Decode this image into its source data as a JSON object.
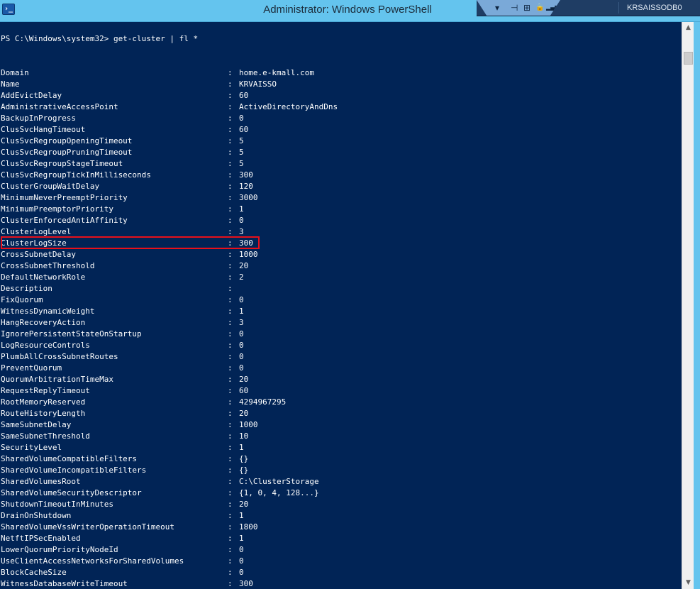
{
  "window": {
    "title": "Administrator: Windows PowerShell",
    "app_icon": "powershell-icon",
    "app_icon_glyph": "›_"
  },
  "remote_bar": {
    "icons": [
      "chevron-down-icon",
      "pin-icon",
      "network-icon",
      "lock-icon",
      "signal-icon"
    ],
    "glyphs": [
      "▾",
      "⊣",
      "⊞",
      "🔒",
      "▂▄▆"
    ],
    "host": "KRSAISSODB0"
  },
  "console": {
    "prompt": "PS C:\\Windows\\system32> get-cluster | fl *",
    "rows": [
      {
        "name": "Domain",
        "value": "home.e-kmall.com"
      },
      {
        "name": "Name",
        "value": "KRVAISSO"
      },
      {
        "name": "AddEvictDelay",
        "value": "60"
      },
      {
        "name": "AdministrativeAccessPoint",
        "value": "ActiveDirectoryAndDns"
      },
      {
        "name": "BackupInProgress",
        "value": "0"
      },
      {
        "name": "ClusSvcHangTimeout",
        "value": "60"
      },
      {
        "name": "ClusSvcRegroupOpeningTimeout",
        "value": "5"
      },
      {
        "name": "ClusSvcRegroupPruningTimeout",
        "value": "5"
      },
      {
        "name": "ClusSvcRegroupStageTimeout",
        "value": "5"
      },
      {
        "name": "ClusSvcRegroupTickInMilliseconds",
        "value": "300"
      },
      {
        "name": "ClusterGroupWaitDelay",
        "value": "120"
      },
      {
        "name": "MinimumNeverPreemptPriority",
        "value": "3000"
      },
      {
        "name": "MinimumPreemptorPriority",
        "value": "1"
      },
      {
        "name": "ClusterEnforcedAntiAffinity",
        "value": "0"
      },
      {
        "name": "ClusterLogLevel",
        "value": "3"
      },
      {
        "name": "ClusterLogSize",
        "value": "300"
      },
      {
        "name": "CrossSubnetDelay",
        "value": "1000"
      },
      {
        "name": "CrossSubnetThreshold",
        "value": "20"
      },
      {
        "name": "DefaultNetworkRole",
        "value": "2"
      },
      {
        "name": "Description",
        "value": ""
      },
      {
        "name": "FixQuorum",
        "value": "0"
      },
      {
        "name": "WitnessDynamicWeight",
        "value": "1"
      },
      {
        "name": "HangRecoveryAction",
        "value": "3"
      },
      {
        "name": "IgnorePersistentStateOnStartup",
        "value": "0"
      },
      {
        "name": "LogResourceControls",
        "value": "0"
      },
      {
        "name": "PlumbAllCrossSubnetRoutes",
        "value": "0"
      },
      {
        "name": "PreventQuorum",
        "value": "0"
      },
      {
        "name": "QuorumArbitrationTimeMax",
        "value": "20"
      },
      {
        "name": "RequestReplyTimeout",
        "value": "60"
      },
      {
        "name": "RootMemoryReserved",
        "value": "4294967295"
      },
      {
        "name": "RouteHistoryLength",
        "value": "20"
      },
      {
        "name": "SameSubnetDelay",
        "value": "1000"
      },
      {
        "name": "SameSubnetThreshold",
        "value": "10"
      },
      {
        "name": "SecurityLevel",
        "value": "1"
      },
      {
        "name": "SharedVolumeCompatibleFilters",
        "value": "{}"
      },
      {
        "name": "SharedVolumeIncompatibleFilters",
        "value": "{}"
      },
      {
        "name": "SharedVolumesRoot",
        "value": "C:\\ClusterStorage"
      },
      {
        "name": "SharedVolumeSecurityDescriptor",
        "value": "{1, 0, 4, 128...}"
      },
      {
        "name": "ShutdownTimeoutInMinutes",
        "value": "20"
      },
      {
        "name": "DrainOnShutdown",
        "value": "1"
      },
      {
        "name": "SharedVolumeVssWriterOperationTimeout",
        "value": "1800"
      },
      {
        "name": "NetftIPSecEnabled",
        "value": "1"
      },
      {
        "name": "LowerQuorumPriorityNodeId",
        "value": "0"
      },
      {
        "name": "UseClientAccessNetworksForSharedVolumes",
        "value": "0"
      },
      {
        "name": "BlockCacheSize",
        "value": "0"
      },
      {
        "name": "WitnessDatabaseWriteTimeout",
        "value": "300"
      }
    ],
    "separator": ":",
    "highlighted_property": "ClusterLogSize"
  },
  "scrollbar": {
    "up_glyph": "▲",
    "down_glyph": "▼"
  },
  "colors": {
    "console_bg": "#012456",
    "console_text": "#ffffff",
    "highlight_border": "#e8101a",
    "titlebar_bg": "#64c4ee"
  }
}
